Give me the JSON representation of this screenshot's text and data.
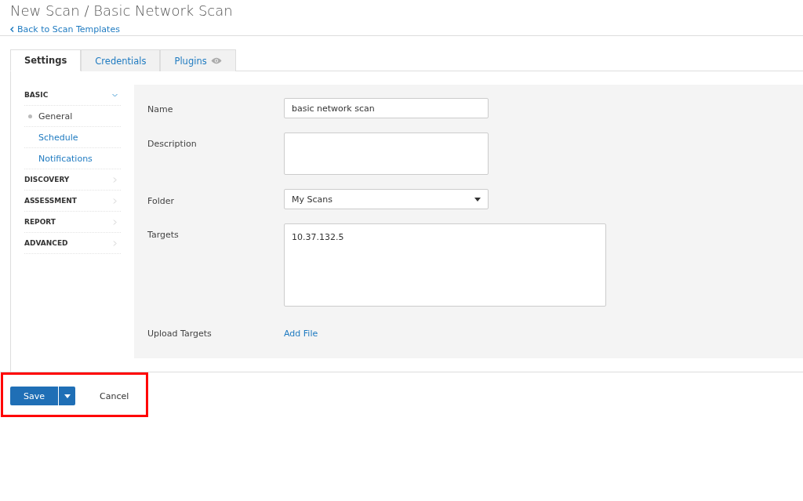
{
  "header": {
    "title": "New Scan / Basic Network Scan",
    "back_link": "Back to Scan Templates"
  },
  "tabs": [
    {
      "label": "Settings",
      "selected": true,
      "eye": false
    },
    {
      "label": "Credentials",
      "selected": false,
      "eye": false
    },
    {
      "label": "Plugins",
      "selected": false,
      "eye": true
    }
  ],
  "sidebar": [
    {
      "label": "BASIC",
      "expanded": true,
      "children": [
        {
          "label": "General",
          "selected": true
        },
        {
          "label": "Schedule",
          "selected": false
        },
        {
          "label": "Notifications",
          "selected": false
        }
      ]
    },
    {
      "label": "DISCOVERY",
      "expanded": false
    },
    {
      "label": "ASSESSMENT",
      "expanded": false
    },
    {
      "label": "REPORT",
      "expanded": false
    },
    {
      "label": "ADVANCED",
      "expanded": false
    }
  ],
  "form": [
    {
      "kind": "text",
      "label": "Name",
      "value": "basic network scan"
    },
    {
      "kind": "textarea",
      "label": "Description"
    },
    {
      "kind": "select",
      "label": "Folder",
      "value": "My Scans"
    },
    {
      "kind": "targets",
      "label": "Targets",
      "value": "10.37.132.5"
    },
    {
      "kind": "file",
      "label": "Upload Targets",
      "link": "Add File"
    }
  ],
  "footer": {
    "save": "Save",
    "cancel": "Cancel",
    "highlighted": true
  }
}
